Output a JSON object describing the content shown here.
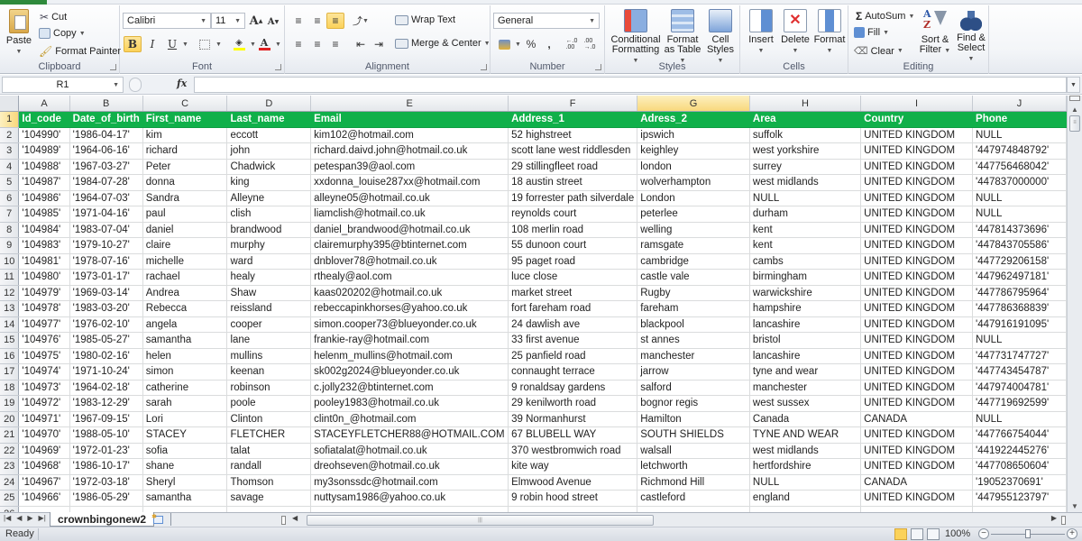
{
  "ribbon": {
    "clipboard": {
      "paste": "Paste",
      "cut": "Cut",
      "copy": "Copy",
      "format_painter": "Format Painter",
      "label": "Clipboard"
    },
    "font": {
      "name": "Calibri",
      "size": "11",
      "grow": "A",
      "shrink": "A",
      "bold": "B",
      "italic": "I",
      "underline": "U",
      "label": "Font"
    },
    "alignment": {
      "wrap_text": "Wrap Text",
      "merge_center": "Merge & Center",
      "label": "Alignment"
    },
    "number": {
      "format": "General",
      "percent": "%",
      "comma": ",",
      "label": "Number"
    },
    "styles": {
      "conditional_formatting_1": "Conditional",
      "conditional_formatting_2": "Formatting",
      "format_as_table_1": "Format",
      "format_as_table_2": "as Table",
      "cell_styles_1": "Cell",
      "cell_styles_2": "Styles",
      "label": "Styles"
    },
    "cells": {
      "insert": "Insert",
      "delete": "Delete",
      "format": "Format",
      "label": "Cells"
    },
    "editing": {
      "autosum": "AutoSum",
      "fill": "Fill",
      "clear": "Clear",
      "sort_filter_1": "Sort &",
      "sort_filter_2": "Filter",
      "find_select_1": "Find &",
      "find_select_2": "Select",
      "label": "Editing"
    }
  },
  "formula_bar": {
    "name_box": "R1",
    "fx": "fx",
    "formula": ""
  },
  "sheet": {
    "column_letters": [
      "A",
      "B",
      "C",
      "D",
      "E",
      "F",
      "G",
      "H",
      "I",
      "J"
    ],
    "selected_column": "G",
    "selected_row": 1,
    "headers": [
      "Id_code",
      "Date_of_birth",
      "First_name",
      "Last_name",
      "Email",
      "Address_1",
      "Adress_2",
      "Area",
      "Country",
      "Phone"
    ],
    "rows": [
      [
        "'104990'",
        "'1986-04-17'",
        "kim",
        "eccott",
        "kim102@hotmail.com",
        "52 highstreet",
        "ipswich",
        "suffolk",
        "UNITED KINGDOM",
        "NULL"
      ],
      [
        "'104989'",
        "'1964-06-16'",
        "richard",
        "john",
        "richard.daivd.john@hotmail.co.uk",
        "scott lane west riddlesden",
        "keighley",
        "west yorkshire",
        "UNITED KINGDOM",
        "'447974848792'"
      ],
      [
        "'104988'",
        "'1967-03-27'",
        "Peter",
        "Chadwick",
        "petespan39@aol.com",
        "29 stillingfleet road",
        "london",
        "surrey",
        "UNITED KINGDOM",
        "'447756468042'"
      ],
      [
        "'104987'",
        "'1984-07-28'",
        "donna",
        "king",
        "xxdonna_louise287xx@hotmail.com",
        "18 austin street",
        "wolverhampton",
        "west midlands",
        "UNITED KINGDOM",
        "'447837000000'"
      ],
      [
        "'104986'",
        "'1964-07-03'",
        "Sandra",
        "Alleyne",
        "alleyne05@hotmail.co.uk",
        "19 forrester path silverdale",
        "London",
        "NULL",
        "UNITED KINGDOM",
        "NULL"
      ],
      [
        "'104985'",
        "'1971-04-16'",
        "paul",
        "clish",
        "liamclish@hotmail.co.uk",
        "reynolds court",
        "peterlee",
        "durham",
        "UNITED KINGDOM",
        "NULL"
      ],
      [
        "'104984'",
        "'1983-07-04'",
        "daniel",
        "brandwood",
        "daniel_brandwood@hotmail.co.uk",
        "108 merlin road",
        "welling",
        "kent",
        "UNITED KINGDOM",
        "'447814373696'"
      ],
      [
        "'104983'",
        "'1979-10-27'",
        "claire",
        "murphy",
        "clairemurphy395@btinternet.com",
        "55 dunoon court",
        "ramsgate",
        "kent",
        "UNITED KINGDOM",
        "'447843705586'"
      ],
      [
        "'104981'",
        "'1978-07-16'",
        "michelle",
        "ward",
        "dnblover78@hotmail.co.uk",
        "95 paget road",
        "cambridge",
        "cambs",
        "UNITED KINGDOM",
        "'447729206158'"
      ],
      [
        "'104980'",
        "'1973-01-17'",
        "rachael",
        "healy",
        "rthealy@aol.com",
        "luce close",
        "castle vale",
        "birmingham",
        "UNITED KINGDOM",
        "'447962497181'"
      ],
      [
        "'104979'",
        "'1969-03-14'",
        "Andrea",
        "Shaw",
        "kaas020202@hotmail.co.uk",
        "market street",
        "Rugby",
        "warwickshire",
        "UNITED KINGDOM",
        "'447786795964'"
      ],
      [
        "'104978'",
        "'1983-03-20'",
        "Rebecca",
        "reissland",
        "rebeccapinkhorses@yahoo.co.uk",
        "fort fareham road",
        "fareham",
        "hampshire",
        "UNITED KINGDOM",
        "'447786368839'"
      ],
      [
        "'104977'",
        "'1976-02-10'",
        "angela",
        "cooper",
        "simon.cooper73@blueyonder.co.uk",
        "24 dawlish ave",
        "blackpool",
        "lancashire",
        "UNITED KINGDOM",
        "'447916191095'"
      ],
      [
        "'104976'",
        "'1985-05-27'",
        "samantha",
        "lane",
        "frankie-ray@hotmail.com",
        "33 first avenue",
        "st annes",
        "bristol",
        "UNITED KINGDOM",
        "NULL"
      ],
      [
        "'104975'",
        "'1980-02-16'",
        "helen",
        "mullins",
        "helenm_mullins@hotmail.com",
        "25 panfield road",
        "manchester",
        "lancashire",
        "UNITED KINGDOM",
        "'447731747727'"
      ],
      [
        "'104974'",
        "'1971-10-24'",
        "simon",
        "keenan",
        "sk002g2024@blueyonder.co.uk",
        "connaught terrace",
        "jarrow",
        "tyne and wear",
        "UNITED KINGDOM",
        "'447743454787'"
      ],
      [
        "'104973'",
        "'1964-02-18'",
        "catherine",
        "robinson",
        "c.jolly232@btinternet.com",
        "9 ronaldsay gardens",
        "salford",
        "manchester",
        "UNITED KINGDOM",
        "'447974004781'"
      ],
      [
        "'104972'",
        "'1983-12-29'",
        "sarah",
        "poole",
        "pooley1983@hotmail.co.uk",
        "29 kenilworth road",
        "bognor regis",
        "west sussex",
        "UNITED KINGDOM",
        "'447719692599'"
      ],
      [
        "'104971'",
        "'1967-09-15'",
        "Lori",
        "Clinton",
        "clint0n_@hotmail.com",
        "39 Normanhurst",
        "Hamilton",
        "Canada",
        "CANADA",
        "NULL"
      ],
      [
        "'104970'",
        "'1988-05-10'",
        "STACEY",
        "FLETCHER",
        "STACEYFLETCHER88@HOTMAIL.COM",
        "67 BLUBELL WAY",
        "SOUTH SHIELDS",
        "TYNE AND WEAR",
        "UNITED KINGDOM",
        "'447766754044'"
      ],
      [
        "'104969'",
        "'1972-01-23'",
        "sofia",
        "talat",
        "sofiatalat@hotmail.co.uk",
        "370 westbromwich road",
        "walsall",
        "west midlands",
        "UNITED KINGDOM",
        "'441922445276'"
      ],
      [
        "'104968'",
        "'1986-10-17'",
        "shane",
        "randall",
        "dreohseven@hotmail.co.uk",
        "kite way",
        "letchworth",
        "hertfordshire",
        "UNITED KINGDOM",
        "'447708650604'"
      ],
      [
        "'104967'",
        "'1972-03-18'",
        "Sheryl",
        "Thomson",
        "my3sonssdc@hotmail.com",
        "Elmwood Avenue",
        "Richmond Hill",
        "NULL",
        "CANADA",
        "'19052370691'"
      ],
      [
        "'104966'",
        "'1986-05-29'",
        "samantha",
        "savage",
        "nuttysam1986@yahoo.co.uk",
        "9 robin hood street",
        "castleford",
        "england",
        "UNITED KINGDOM",
        "'447955123797'"
      ]
    ]
  },
  "tabs": {
    "active_sheet": "crownbingonew2"
  },
  "status": {
    "text": "Ready",
    "zoom": "100%",
    "zoom_percent": 100
  },
  "colors": {
    "header_fill": "#10b04a",
    "header_text": "#ffffff",
    "selection_highlight": "#f8d87c"
  }
}
